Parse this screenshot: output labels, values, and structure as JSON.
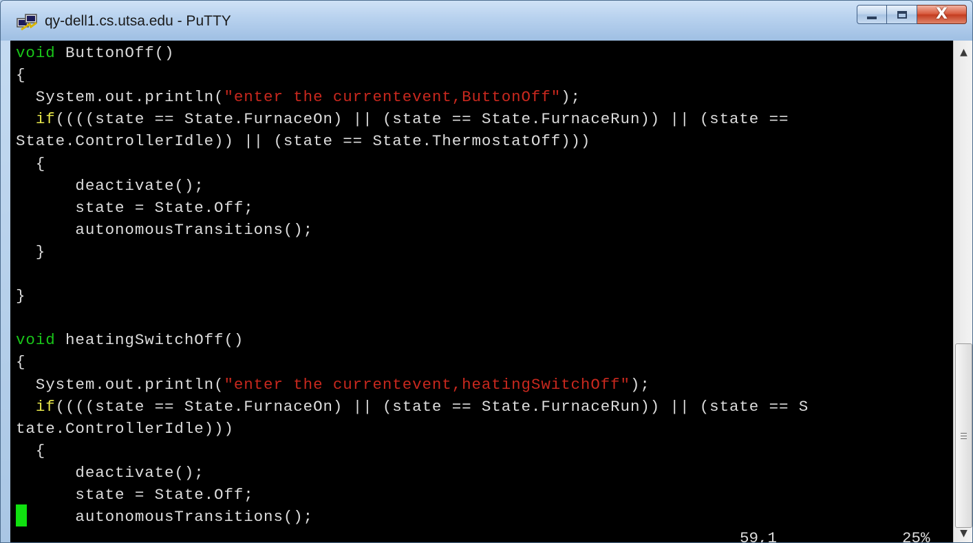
{
  "window": {
    "title": "qy-dell1.cs.utsa.edu - PuTTY",
    "close_glyph": "X",
    "icons": {
      "app": "putty-app-icon",
      "minimize": "minimize-icon",
      "maximize": "maximize-icon",
      "close": "close-icon"
    }
  },
  "terminal": {
    "colors": {
      "background": "#000000",
      "text": "#dcdcdc",
      "keyword_void": "#19c419",
      "keyword_if": "#e6e64a",
      "string": "#c8281e",
      "cursor": "#10e010"
    },
    "lines": [
      [
        {
          "c": "kw2",
          "t": "void"
        },
        {
          "c": "",
          "t": " ButtonOff()"
        }
      ],
      [
        {
          "c": "",
          "t": "{"
        }
      ],
      [
        {
          "c": "",
          "t": "  System.out.println("
        },
        {
          "c": "str",
          "t": "\"enter the currentevent,ButtonOff\""
        },
        {
          "c": "",
          "t": ");"
        }
      ],
      [
        {
          "c": "",
          "t": "  "
        },
        {
          "c": "kw",
          "t": "if"
        },
        {
          "c": "",
          "t": "((((state == State.FurnaceOn) || (state == State.FurnaceRun)) || (state =="
        }
      ],
      [
        {
          "c": "",
          "t": "State.ControllerIdle)) || (state == State.ThermostatOff)))"
        }
      ],
      [
        {
          "c": "",
          "t": "  {"
        }
      ],
      [
        {
          "c": "",
          "t": "      deactivate();"
        }
      ],
      [
        {
          "c": "",
          "t": "      state = State.Off;"
        }
      ],
      [
        {
          "c": "",
          "t": "      autonomousTransitions();"
        }
      ],
      [
        {
          "c": "",
          "t": "  }"
        }
      ],
      [
        {
          "c": "",
          "t": ""
        }
      ],
      [
        {
          "c": "",
          "t": "}"
        }
      ],
      [
        {
          "c": "",
          "t": ""
        }
      ],
      [
        {
          "c": "kw2",
          "t": "void"
        },
        {
          "c": "",
          "t": " heatingSwitchOff()"
        }
      ],
      [
        {
          "c": "",
          "t": "{"
        }
      ],
      [
        {
          "c": "",
          "t": "  System.out.println("
        },
        {
          "c": "str",
          "t": "\"enter the currentevent,heatingSwitchOff\""
        },
        {
          "c": "",
          "t": ");"
        }
      ],
      [
        {
          "c": "",
          "t": "  "
        },
        {
          "c": "kw",
          "t": "if"
        },
        {
          "c": "",
          "t": "((((state == State.FurnaceOn) || (state == State.FurnaceRun)) || (state == S"
        }
      ],
      [
        {
          "c": "",
          "t": "tate.ControllerIdle)))"
        }
      ],
      [
        {
          "c": "",
          "t": "  {"
        }
      ],
      [
        {
          "c": "",
          "t": "      deactivate();"
        }
      ],
      [
        {
          "c": "",
          "t": "      state = State.Off;"
        }
      ],
      [
        {
          "c": "",
          "t": "      autonomousTransitions();"
        }
      ]
    ],
    "status": {
      "position": "59,1",
      "percent": "25%"
    }
  },
  "scrollbar": {
    "up_glyph": "▲",
    "down_glyph": "▼",
    "icons": {
      "up": "scroll-up-arrow-icon",
      "down": "scroll-down-arrow-icon",
      "grip": "grip-icon"
    }
  }
}
